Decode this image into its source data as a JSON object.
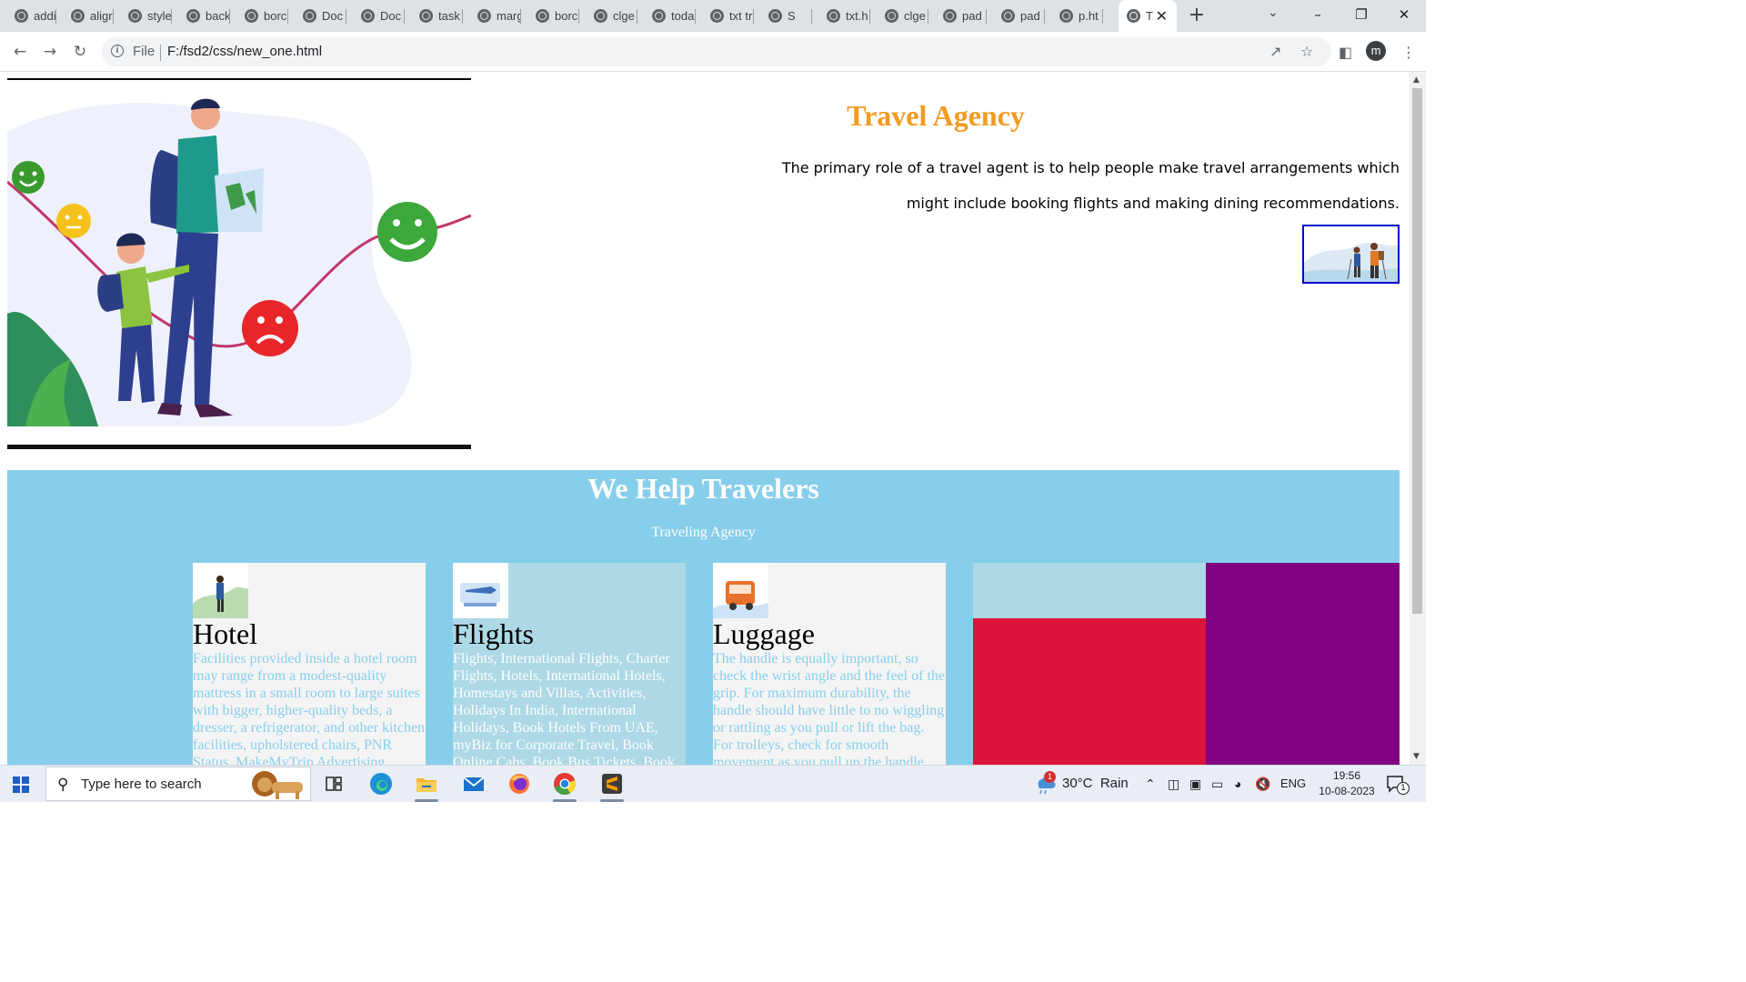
{
  "browser": {
    "tabs": [
      {
        "label": "addi"
      },
      {
        "label": "aligr"
      },
      {
        "label": "style"
      },
      {
        "label": "back"
      },
      {
        "label": "borc"
      },
      {
        "label": "Doc"
      },
      {
        "label": "Doc"
      },
      {
        "label": "task"
      },
      {
        "label": "marg"
      },
      {
        "label": "borc"
      },
      {
        "label": "clge"
      },
      {
        "label": "toda"
      },
      {
        "label": "txt tr"
      },
      {
        "label": "S"
      },
      {
        "label": "txt.h"
      },
      {
        "label": "clge"
      },
      {
        "label": "pad"
      },
      {
        "label": "pad"
      },
      {
        "label": "p.ht"
      },
      {
        "label": "T",
        "active": true
      }
    ],
    "address": {
      "scheme": "File",
      "url": "F:/fsd2/css/new_one.html"
    },
    "profile_initial": "m"
  },
  "page": {
    "title": "Travel Agency",
    "description": "The primary role of a travel agent is to help people make travel arrangements which might include booking flights and making dining recommendations.",
    "band": {
      "heading": "We Help Travelers",
      "subheading": "Traveling Agency",
      "cards": [
        {
          "title": "Hotel",
          "text": "Facilities provided inside a hotel room may range from a modest-quality mattress in a small room to large suites with bigger, higher-quality beds, a dresser, a refrigerator, and other kitchen facilities, upholstered chairs, PNR Status, MakeMyTrip Advertising"
        },
        {
          "title": "Flights",
          "text": "Flights, International Flights, Charter Flights, Hotels, International Hotels, Homestays and Villas, Activities, Holidays In India, International Holidays, Book Hotels From UAE, myBiz for Corporate Travel, Book Online Cabs, Book Bus Tickets, Book"
        },
        {
          "title": "Luggage",
          "text": "The handle is equally important, so check the wrist angle and the feel of the grip. For maximum durability, the handle should have little to no wiggling or rattling as you pull or lift the bag. For trolleys, check for smooth movement as you pull up the handle"
        }
      ],
      "colors": {
        "band": "#87ceeb",
        "card_light": "#f4f4f4",
        "card_blue": "#add8e6",
        "red": "#dc143c",
        "purple": "#800080"
      }
    }
  },
  "taskbar": {
    "search_placeholder": "Type here to search",
    "weather": "30°C  Rain",
    "weather_badge": "1",
    "language": "ENG",
    "time": "19:56",
    "date": "10-08-2023",
    "notification_count": "1"
  }
}
